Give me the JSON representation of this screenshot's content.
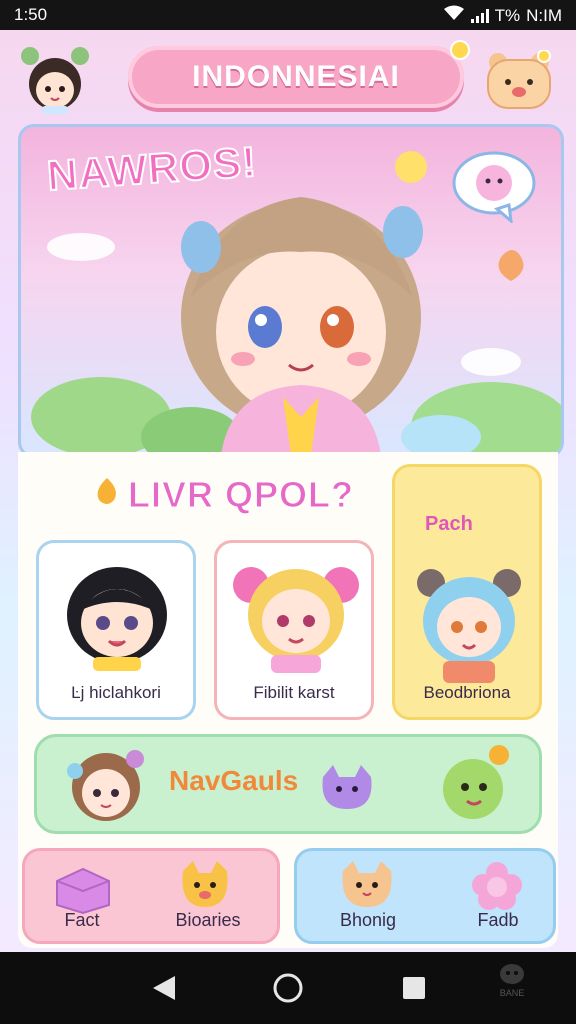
{
  "status_bar": {
    "time": "1:50",
    "battery_text": "T%",
    "network_text": "N:IM"
  },
  "header": {
    "title": "INDONNESIAI"
  },
  "hero": {
    "title": "NAWROS!"
  },
  "section": {
    "title": "LIVR QPOL?"
  },
  "cards": [
    {
      "label": "Ŀj hiclahkori"
    },
    {
      "label": "Fibilit karst"
    },
    {
      "label": "Beodbriona",
      "tag": "Pach"
    }
  ],
  "banner": {
    "label": "NavGauls"
  },
  "bottom_buttons": [
    {
      "left_label": "Fact",
      "right_label": "Bioaries"
    },
    {
      "left_label": "Bhonig",
      "right_label": "Fadb"
    }
  ],
  "nav": {
    "corner_label": "BANE"
  },
  "colors": {
    "accent_pink": "#f7a6c6",
    "banner_green": "#c9f0cf",
    "card_yellow": "#fde99a",
    "button_blue": "#bfe4fb"
  },
  "icons": [
    "wifi-icon",
    "signal-icon",
    "back-icon",
    "home-icon",
    "recents-icon",
    "game-icon",
    "bear-icon",
    "speech-bubble-icon"
  ]
}
